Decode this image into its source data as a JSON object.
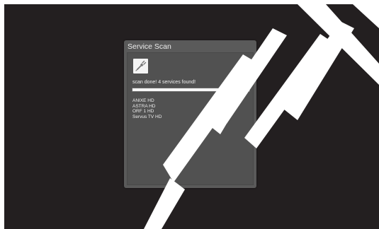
{
  "dialog": {
    "title": "Service Scan",
    "icon": "antenna-plug-icon",
    "status": "scan done! 4 services found!",
    "progress": 1.0,
    "services": [
      "ANIXE HD",
      "ASTRA HD",
      "ORF 1 HD",
      "Servus TV HD"
    ]
  },
  "colors": {
    "screen_bg": "#231f20",
    "dialog_bg": "#5a5a5a",
    "progress_fill": "#f7f7f7",
    "watermark": "#ffffff"
  }
}
